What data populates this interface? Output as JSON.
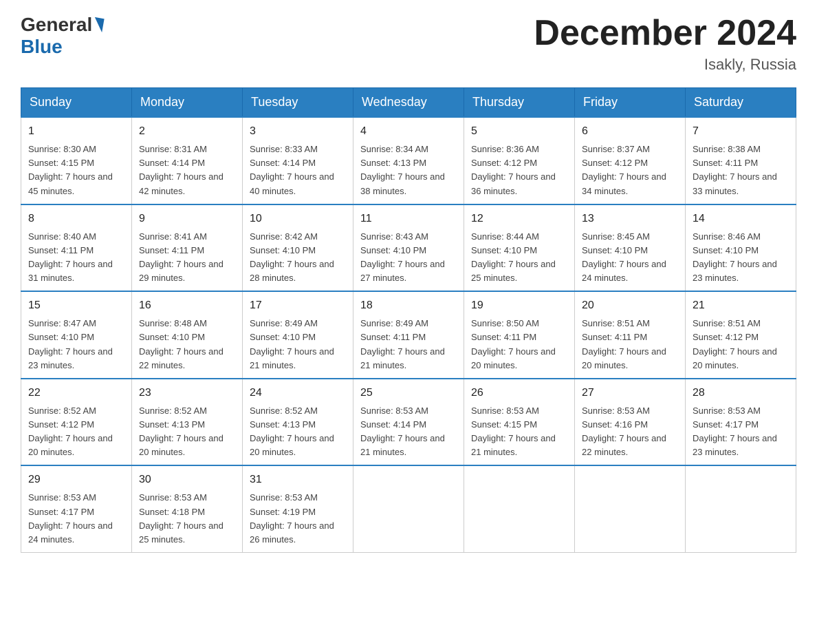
{
  "header": {
    "logo_general": "General",
    "logo_blue": "Blue",
    "month_title": "December 2024",
    "location": "Isakly, Russia"
  },
  "weekdays": [
    "Sunday",
    "Monday",
    "Tuesday",
    "Wednesday",
    "Thursday",
    "Friday",
    "Saturday"
  ],
  "weeks": [
    [
      {
        "day": "1",
        "sunrise": "8:30 AM",
        "sunset": "4:15 PM",
        "daylight": "7 hours and 45 minutes."
      },
      {
        "day": "2",
        "sunrise": "8:31 AM",
        "sunset": "4:14 PM",
        "daylight": "7 hours and 42 minutes."
      },
      {
        "day": "3",
        "sunrise": "8:33 AM",
        "sunset": "4:14 PM",
        "daylight": "7 hours and 40 minutes."
      },
      {
        "day": "4",
        "sunrise": "8:34 AM",
        "sunset": "4:13 PM",
        "daylight": "7 hours and 38 minutes."
      },
      {
        "day": "5",
        "sunrise": "8:36 AM",
        "sunset": "4:12 PM",
        "daylight": "7 hours and 36 minutes."
      },
      {
        "day": "6",
        "sunrise": "8:37 AM",
        "sunset": "4:12 PM",
        "daylight": "7 hours and 34 minutes."
      },
      {
        "day": "7",
        "sunrise": "8:38 AM",
        "sunset": "4:11 PM",
        "daylight": "7 hours and 33 minutes."
      }
    ],
    [
      {
        "day": "8",
        "sunrise": "8:40 AM",
        "sunset": "4:11 PM",
        "daylight": "7 hours and 31 minutes."
      },
      {
        "day": "9",
        "sunrise": "8:41 AM",
        "sunset": "4:11 PM",
        "daylight": "7 hours and 29 minutes."
      },
      {
        "day": "10",
        "sunrise": "8:42 AM",
        "sunset": "4:10 PM",
        "daylight": "7 hours and 28 minutes."
      },
      {
        "day": "11",
        "sunrise": "8:43 AM",
        "sunset": "4:10 PM",
        "daylight": "7 hours and 27 minutes."
      },
      {
        "day": "12",
        "sunrise": "8:44 AM",
        "sunset": "4:10 PM",
        "daylight": "7 hours and 25 minutes."
      },
      {
        "day": "13",
        "sunrise": "8:45 AM",
        "sunset": "4:10 PM",
        "daylight": "7 hours and 24 minutes."
      },
      {
        "day": "14",
        "sunrise": "8:46 AM",
        "sunset": "4:10 PM",
        "daylight": "7 hours and 23 minutes."
      }
    ],
    [
      {
        "day": "15",
        "sunrise": "8:47 AM",
        "sunset": "4:10 PM",
        "daylight": "7 hours and 23 minutes."
      },
      {
        "day": "16",
        "sunrise": "8:48 AM",
        "sunset": "4:10 PM",
        "daylight": "7 hours and 22 minutes."
      },
      {
        "day": "17",
        "sunrise": "8:49 AM",
        "sunset": "4:10 PM",
        "daylight": "7 hours and 21 minutes."
      },
      {
        "day": "18",
        "sunrise": "8:49 AM",
        "sunset": "4:11 PM",
        "daylight": "7 hours and 21 minutes."
      },
      {
        "day": "19",
        "sunrise": "8:50 AM",
        "sunset": "4:11 PM",
        "daylight": "7 hours and 20 minutes."
      },
      {
        "day": "20",
        "sunrise": "8:51 AM",
        "sunset": "4:11 PM",
        "daylight": "7 hours and 20 minutes."
      },
      {
        "day": "21",
        "sunrise": "8:51 AM",
        "sunset": "4:12 PM",
        "daylight": "7 hours and 20 minutes."
      }
    ],
    [
      {
        "day": "22",
        "sunrise": "8:52 AM",
        "sunset": "4:12 PM",
        "daylight": "7 hours and 20 minutes."
      },
      {
        "day": "23",
        "sunrise": "8:52 AM",
        "sunset": "4:13 PM",
        "daylight": "7 hours and 20 minutes."
      },
      {
        "day": "24",
        "sunrise": "8:52 AM",
        "sunset": "4:13 PM",
        "daylight": "7 hours and 20 minutes."
      },
      {
        "day": "25",
        "sunrise": "8:53 AM",
        "sunset": "4:14 PM",
        "daylight": "7 hours and 21 minutes."
      },
      {
        "day": "26",
        "sunrise": "8:53 AM",
        "sunset": "4:15 PM",
        "daylight": "7 hours and 21 minutes."
      },
      {
        "day": "27",
        "sunrise": "8:53 AM",
        "sunset": "4:16 PM",
        "daylight": "7 hours and 22 minutes."
      },
      {
        "day": "28",
        "sunrise": "8:53 AM",
        "sunset": "4:17 PM",
        "daylight": "7 hours and 23 minutes."
      }
    ],
    [
      {
        "day": "29",
        "sunrise": "8:53 AM",
        "sunset": "4:17 PM",
        "daylight": "7 hours and 24 minutes."
      },
      {
        "day": "30",
        "sunrise": "8:53 AM",
        "sunset": "4:18 PM",
        "daylight": "7 hours and 25 minutes."
      },
      {
        "day": "31",
        "sunrise": "8:53 AM",
        "sunset": "4:19 PM",
        "daylight": "7 hours and 26 minutes."
      },
      null,
      null,
      null,
      null
    ]
  ]
}
